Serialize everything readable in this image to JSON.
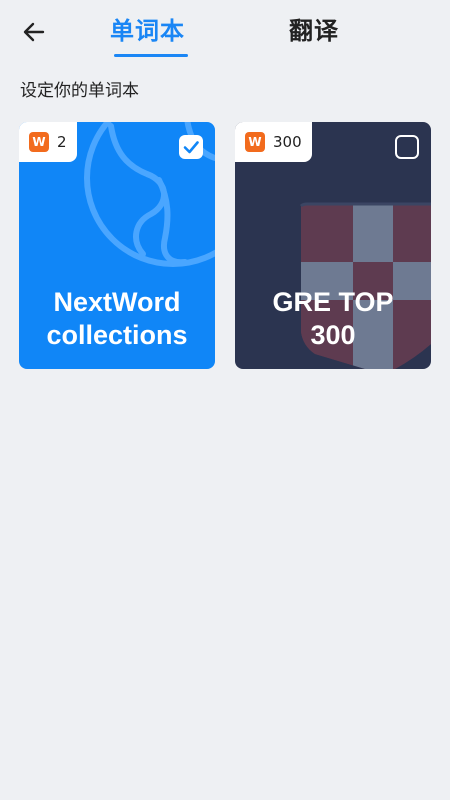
{
  "header": {
    "tabs": [
      {
        "label": "单词本",
        "active": true
      },
      {
        "label": "翻译",
        "active": false
      }
    ]
  },
  "section": {
    "title": "设定你的单词本"
  },
  "cards": [
    {
      "badge_icon": "W",
      "count": "2",
      "title_line1": "NextWord",
      "title_line2": "collections",
      "selected": true,
      "bg": "#1086f7",
      "icon": "globe-icon"
    },
    {
      "badge_icon": "W",
      "count": "300",
      "title_line1": "GRE TOP",
      "title_line2": "300",
      "selected": false,
      "bg": "#2b3450",
      "icon": "shield-icon"
    }
  ],
  "colors": {
    "accent": "#1a86f5",
    "background": "#eef0f3",
    "badge_orange": "#f26b1d"
  }
}
